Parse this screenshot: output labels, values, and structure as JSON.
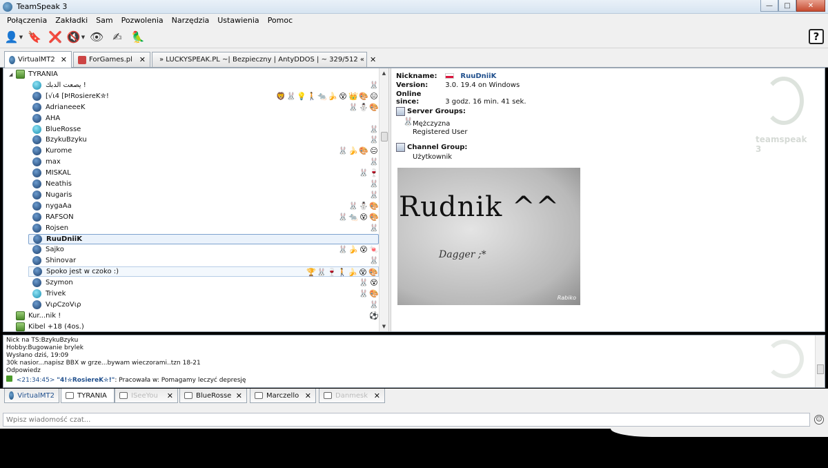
{
  "window": {
    "title": "TeamSpeak 3"
  },
  "menu": [
    "Połączenia",
    "Zakładki",
    "Sam",
    "Pozwolenia",
    "Narzędzia",
    "Ustawienia",
    "Pomoc"
  ],
  "toolbar": {
    "icons": [
      "connect-icon",
      "bookmark-icon",
      "disconnect-icon",
      "mute-icon",
      "away-icon",
      "register-icon",
      "avatar-icon"
    ],
    "help_label": "?"
  },
  "server_tabs": [
    {
      "label": "VirtualMT2",
      "close": "✕",
      "active": true
    },
    {
      "label": "ForGames.pl",
      "close": "✕",
      "active": false
    },
    {
      "label": "» LUCKYSPEAK.PL ~| Bezpieczny | AntyDDOS | ~ 329/512 «",
      "close": "✕",
      "active": false
    }
  ],
  "tree": {
    "channel": "TYRANIA",
    "users": [
      {
        "name": "يصعت الدبك   !",
        "badges": [
          "🐰"
        ]
      },
      {
        "name": "[√ι4 [ϷǃRosiereK✮!",
        "badges": [
          "🦁",
          "🐰",
          "💡",
          "🚶",
          "🐀",
          "🍌",
          "😵",
          "👑",
          "🎨",
          "😐"
        ]
      },
      {
        "name": "AdrianeeeK",
        "badges": [
          "🐰",
          "⛄",
          "🎨"
        ]
      },
      {
        "name": "AHA",
        "badges": []
      },
      {
        "name": "BlueRosse",
        "badges": [
          "🐰"
        ]
      },
      {
        "name": "BzykuBzyku",
        "badges": [
          "🐰"
        ]
      },
      {
        "name": "Kurome",
        "badges": [
          "🐰",
          "🍌",
          "🎨",
          "😐"
        ]
      },
      {
        "name": "max",
        "badges": [
          "🐰"
        ]
      },
      {
        "name": "MISKAL",
        "badges": [
          "🐰",
          "🍷"
        ]
      },
      {
        "name": "Neathis",
        "badges": [
          "🐰"
        ]
      },
      {
        "name": "Nugaris",
        "badges": [
          "🐰"
        ]
      },
      {
        "name": "nygaAa",
        "badges": [
          "🐰",
          "⛄",
          "🎨"
        ]
      },
      {
        "name": "RAFSON",
        "badges": [
          "🐰",
          "🐀",
          "😵",
          "🎨"
        ]
      },
      {
        "name": "Rojsen",
        "badges": [
          "🐰"
        ]
      },
      {
        "name": "RuuDniiK",
        "badges": []
      },
      {
        "name": "Sajko",
        "badges": [
          "🐰",
          "🍌",
          "😵",
          "🍬"
        ]
      },
      {
        "name": "Shinovar",
        "badges": [
          "🐰"
        ]
      },
      {
        "name": "Spoko jest w czoko :)",
        "badges": [
          "🏆",
          "🐰",
          "🍷",
          "🚶",
          "🍌",
          "😵",
          "🎨"
        ]
      },
      {
        "name": "Szymon",
        "badges": [
          "🐰",
          "😵"
        ]
      },
      {
        "name": "Trivek",
        "badges": [
          "🐰",
          "🎨"
        ]
      },
      {
        "name": "VιρCzoVιρ",
        "badges": [
          "🐰"
        ]
      }
    ],
    "more_channels": [
      {
        "name": "Kur...nik !",
        "badge": "⚽"
      },
      {
        "name": "Kibel +18 (4os.)",
        "badge": ""
      }
    ]
  },
  "info": {
    "nickname_label": "Nickname:",
    "nickname": "RuuDniiK",
    "version_label": "Version:",
    "version": "3.0. 19.4 on Windows",
    "online_label": "Online since:",
    "online": "3 godz. 16 min. 41 sek.",
    "server_groups_label": "Server Groups:",
    "server_groups": [
      "Mężczyzna",
      "Registered User"
    ],
    "channel_group_label": "Channel Group:",
    "channel_group": "Użytkownik",
    "avatar_text_big": "Rudnik ^^",
    "avatar_text_small": "Dagger ;*",
    "avatar_watermark": "Rabiko",
    "logo_text": "teamspeak 3"
  },
  "chat": {
    "lines": [
      "Nick na TS:BzykuBzyku",
      "Hobby:Bugowanie brylek",
      "Wysłano dziś, 19:09",
      "30k nasior...napisz BBX w grze...bywam wieczorami..tzn 18-21",
      "Odpowiedz"
    ],
    "last": {
      "time": "<21:34:45>",
      "who": "\"4!✮RosiereK✮!\"",
      "text": ": Pracowała w: Pomagamy leczyć depresję"
    }
  },
  "chat_tabs": [
    {
      "label": "VirtualMT2",
      "active": false,
      "dim": false
    },
    {
      "label": "TYRANIA",
      "active": true,
      "dim": false
    },
    {
      "label": "ISeeYou",
      "active": false,
      "dim": true
    },
    {
      "label": "BlueRosse",
      "active": false,
      "dim": false
    },
    {
      "label": "Marczello",
      "active": false,
      "dim": false
    },
    {
      "label": "Danmesk",
      "active": false,
      "dim": true
    }
  ],
  "chat_input": {
    "placeholder": "Wpisz wiadomość czat..."
  },
  "colors": {
    "accent": "#1e4e8c",
    "selection": "#eaf2fb",
    "window_bg": "#f0f0f0"
  }
}
